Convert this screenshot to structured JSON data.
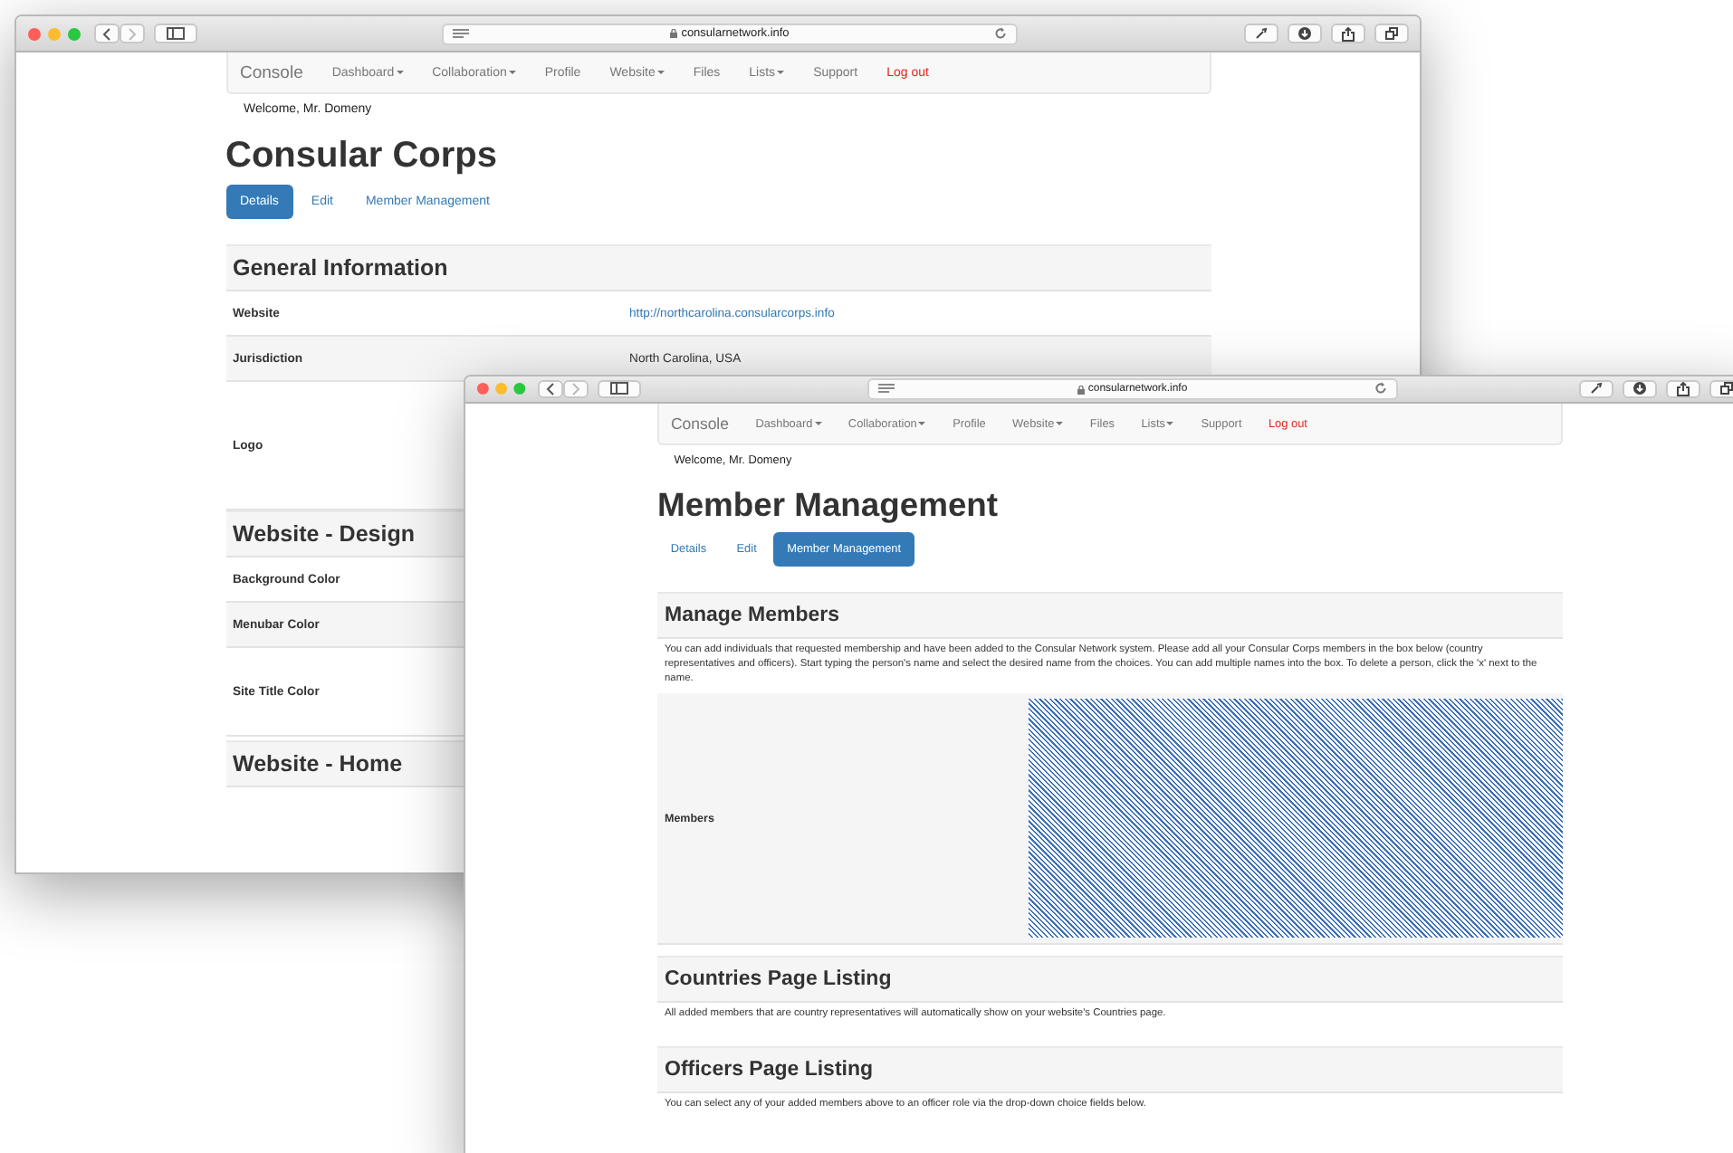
{
  "windows": [
    {
      "address": "consularnetwork.info",
      "nav": {
        "brand": "Console",
        "items": [
          {
            "label": "Dashboard",
            "dropdown": true,
            "danger": false
          },
          {
            "label": "Collaboration",
            "dropdown": true,
            "danger": false
          },
          {
            "label": "Profile",
            "dropdown": false,
            "danger": false
          },
          {
            "label": "Website",
            "dropdown": true,
            "danger": false
          },
          {
            "label": "Files",
            "dropdown": false,
            "danger": false
          },
          {
            "label": "Lists",
            "dropdown": true,
            "danger": false
          },
          {
            "label": "Support",
            "dropdown": false,
            "danger": false
          },
          {
            "label": "Log out",
            "dropdown": false,
            "danger": true
          }
        ]
      },
      "welcome": "Welcome, Mr. Domeny",
      "title": "Consular Corps",
      "tabs": [
        {
          "label": "Details",
          "selected": true
        },
        {
          "label": "Edit",
          "selected": false
        },
        {
          "label": "Member Management",
          "selected": false
        }
      ],
      "sections": [
        {
          "heading": "General Information",
          "rows": [
            {
              "label": "Website",
              "kind": "link",
              "value": "http://northcarolina.consularcorps.info"
            },
            {
              "label": "Jurisdiction",
              "kind": "text",
              "value": "North Carolina, USA"
            },
            {
              "label": "Logo",
              "kind": "empty"
            }
          ]
        },
        {
          "heading": "Website - Design",
          "rows": [
            {
              "label": "Background Color",
              "kind": "empty"
            },
            {
              "label": "Menubar Color",
              "kind": "empty"
            },
            {
              "label": "Site Title Color",
              "kind": "empty"
            }
          ]
        },
        {
          "heading": "Website - Home"
        }
      ]
    },
    {
      "address": "consularnetwork.info",
      "nav": {
        "brand": "Console",
        "items": [
          {
            "label": "Dashboard",
            "dropdown": true,
            "danger": false
          },
          {
            "label": "Collaboration",
            "dropdown": true,
            "danger": false
          },
          {
            "label": "Profile",
            "dropdown": false,
            "danger": false
          },
          {
            "label": "Website",
            "dropdown": true,
            "danger": false
          },
          {
            "label": "Files",
            "dropdown": false,
            "danger": false
          },
          {
            "label": "Lists",
            "dropdown": true,
            "danger": false
          },
          {
            "label": "Support",
            "dropdown": false,
            "danger": false
          },
          {
            "label": "Log out",
            "dropdown": false,
            "danger": true
          }
        ]
      },
      "welcome": "Welcome, Mr. Domeny",
      "title": "Member Management",
      "tabs": [
        {
          "label": "Details",
          "selected": false
        },
        {
          "label": "Edit",
          "selected": false
        },
        {
          "label": "Member Management",
          "selected": true
        }
      ],
      "sections": [
        {
          "heading": "Manage Members",
          "description": "You can add individuals that requested membership and have been added to the Consular Network system. Please add all your Consular Corps members in the box below (country representatives and officers). Start typing the person's name and select the desired name from the choices. You can add multiple names into the box. To delete a person, click the 'x' next to the name.",
          "rows": [
            {
              "label": "Members",
              "kind": "hatched"
            }
          ]
        },
        {
          "heading": "Countries Page Listing",
          "description": "All added members that are country representatives will automatically show on your website's Countries page."
        },
        {
          "heading": "Officers Page Listing",
          "description": "You can select any of your added members above to an officer role via the drop-down choice fields below."
        }
      ]
    }
  ]
}
